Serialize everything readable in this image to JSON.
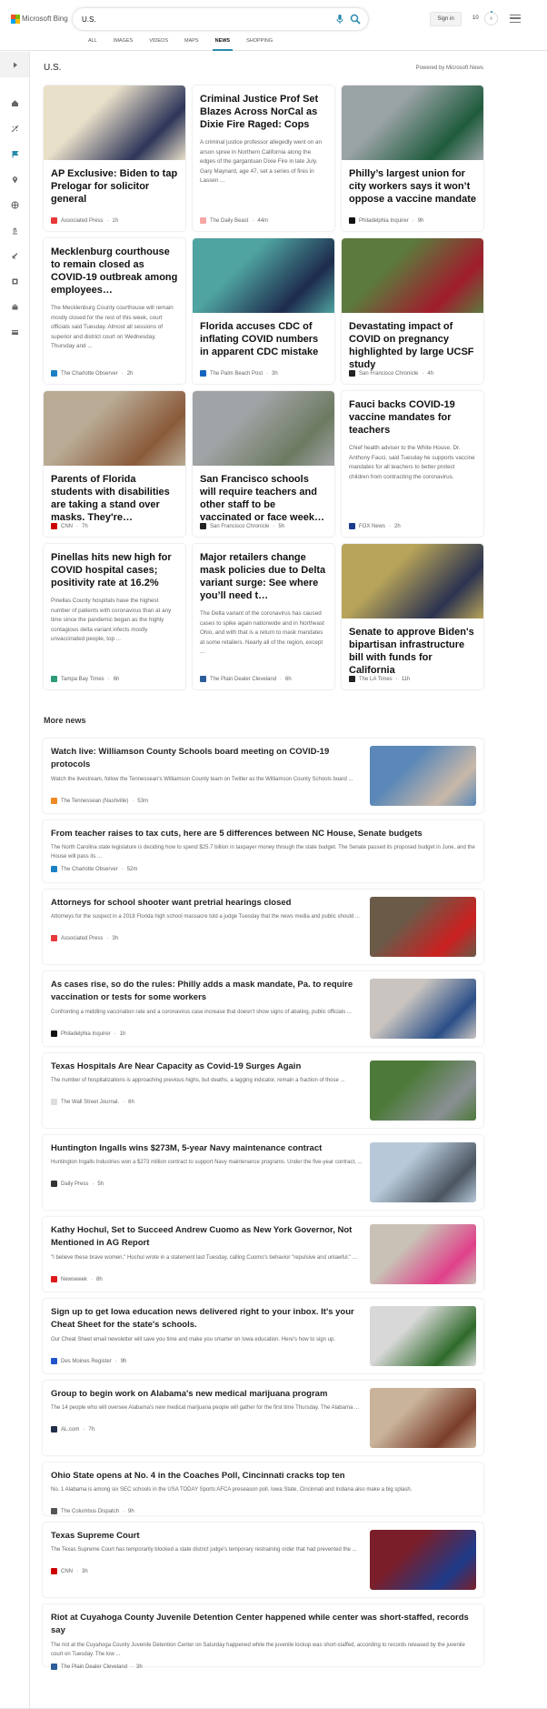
{
  "header": {
    "brand": "Microsoft Bing",
    "logo_colors": [
      "#f25022",
      "#7fba00",
      "#00a4ef",
      "#ffb900"
    ],
    "search_value": "U.S.",
    "tabs": [
      {
        "label": "ALL"
      },
      {
        "label": "IMAGES"
      },
      {
        "label": "VIDEOS"
      },
      {
        "label": "MAPS"
      },
      {
        "label": "NEWS",
        "active": true
      },
      {
        "label": "SHOPPING"
      }
    ],
    "signin": "Sign in",
    "points": "10",
    "accent": "#2a8bad"
  },
  "sidebar": {
    "items": [
      "chevron-right",
      "home",
      "sports",
      "flag",
      "location-pin",
      "globe",
      "microscope",
      "rocket",
      "film",
      "bank",
      "credit-card"
    ]
  },
  "section": {
    "title": "U.S.",
    "powered_by": "Powered by Microsoft News"
  },
  "cards": [
    {
      "title": "AP Exclusive: Biden to tap Prelogar for solicitor general",
      "source": "Associated Press",
      "time": "1h",
      "logo": "#e8383b",
      "img": [
        "#e9e0c9",
        "#2d3558"
      ]
    },
    {
      "title": "Criminal Justice Prof Set Blazes Across NorCal as Dixie Fire Raged: Cops",
      "snippet": "A criminal justice professor allegedly went on an arson spree in Northern California along the edges of the gargantuan Dixie Fire in late July. Gary Maynard, age 47, set a series of fires in Lassen ...",
      "source": "The Daily Beast",
      "time": "44m",
      "logo": "#f7a6a6"
    },
    {
      "title": "Philly’s largest union for city workers says it won’t oppose a vaccine mandate",
      "source": "Philadelphia Inquirer",
      "time": "9h",
      "logo": "#111111",
      "img": [
        "#9aa3a6",
        "#1f5b3d"
      ]
    },
    {
      "title": "Mecklenburg courthouse to remain closed as COVID-19 outbreak among employees…",
      "snippet": "The Mecklenburg County courthouse will remain mostly closed for the rest of this week, court officials said Tuesday. Almost all sessions of superior and district court on Wednesday, Thursday and ...",
      "source": "The Charlotte Observer",
      "time": "2h",
      "logo": "#1d7fc4"
    },
    {
      "title": "Florida accuses CDC of inflating COVID numbers in apparent CDC mistake",
      "source": "The Palm Beach Post",
      "time": "3h",
      "logo": "#1565c0",
      "img": [
        "#4fa3a0",
        "#1d2b4c"
      ]
    },
    {
      "title": "Devastating impact of COVID on pregnancy highlighted by large UCSF study",
      "source": "San Francisco Chronicle",
      "time": "4h",
      "logo": "#222222",
      "img": [
        "#5c7a3d",
        "#a01c2c"
      ]
    },
    {
      "title": "Parents of Florida students with disabilities are taking a stand over masks. They're…",
      "source": "CNN",
      "time": "7h",
      "logo": "#cc0000",
      "img": [
        "#b9ab95",
        "#8a5a3a"
      ]
    },
    {
      "title": "San Francisco schools will require teachers and other staff to be vaccinated or face week…",
      "source": "San Francisco Chronicle",
      "time": "5h",
      "logo": "#222222",
      "img": [
        "#a1a4a6",
        "#6d7a61"
      ]
    },
    {
      "title": "Fauci backs COVID-19 vaccine mandates for teachers",
      "snippet": "Chief health adviser to the White House, Dr. Anthony Fauci, said Tuesday he supports vaccine mandates for all teachers to better protect children from contracting the coronavirus.",
      "source": "FOX News",
      "time": "2h",
      "logo": "#1a3b8c"
    },
    {
      "title": "Pinellas hits new high for COVID hospital cases; positivity rate at 16.2%",
      "snippet": "Pinellas County hospitals have the highest number of patients with coronavirus than at any time since the pandemic began as the highly contagious delta variant infects mostly unvaccinated people, top ...",
      "source": "Tampa Bay Times",
      "time": "6h",
      "logo": "#2e9b7a"
    },
    {
      "title": "Major retailers change mask policies due to Delta variant surge: See where you’ll need t…",
      "snippet": "The Delta variant of the coronavirus has caused cases to spike again nationwide and in Northeast Ohio, and with that is a return to mask mandates at some retailers. Nearly all of the region, except ...",
      "source": "The Plain Dealer Cleveland",
      "time": "6h",
      "logo": "#2b5d9a"
    },
    {
      "title": "Senate to approve Biden's bipartisan infrastructure bill with funds for California",
      "source": "The LA Times",
      "time": "11h",
      "logo": "#222222",
      "img": [
        "#b8a45a",
        "#2b3350"
      ]
    }
  ],
  "more_news": {
    "title": "More news",
    "items": [
      {
        "title": "Watch live: Williamson County Schools board meeting on COVID-19 protocols",
        "snippet": "Watch the livestream, follow the Tennessean's Williamson County team on Twitter as the Williamson County Schools board ...",
        "source": "The Tennessean (Nashville)",
        "time": "53m",
        "logo": "#f08a24",
        "img": [
          "#5b88b8",
          "#c9b8a8"
        ]
      },
      {
        "title": "From teacher raises to tax cuts, here are 5 differences between NC House, Senate budgets",
        "snippet": "The North Carolina state legislature is deciding how to spend $25.7 billion in taxpayer money through the state budget. The Senate passed its proposed budget in June, and the House will pass its ...",
        "source": "The Charlotte Observer",
        "time": "52m",
        "logo": "#1d7fc4"
      },
      {
        "title": "Attorneys for school shooter want pretrial hearings closed",
        "snippet": "Attorneys for the suspect in a 2018 Florida high school massacre told a judge Tuesday that the news media and public should ...",
        "source": "Associated Press",
        "time": "3h",
        "logo": "#e8383b",
        "img": [
          "#6b5a48",
          "#cc2020"
        ]
      },
      {
        "title": "As cases rise, so do the rules: Philly adds a mask mandate, Pa. to require vaccination or tests for some workers",
        "snippet": "Confronting a middling vaccination rate and a coronavirus case increase that doesn't show signs of abating, public officials ...",
        "source": "Philadelphia Inquirer",
        "time": "1h",
        "logo": "#111111",
        "img": [
          "#c9c4bf",
          "#2b4f88"
        ]
      },
      {
        "title": "Texas Hospitals Are Near Capacity as Covid-19 Surges Again",
        "snippet": "The number of hospitalizations is approaching previous highs, but deaths, a lagging indicator, remain a fraction of those ...",
        "source": "The Wall Street Journal.",
        "time": "6h",
        "logo": "#dddddd",
        "img": [
          "#4d7a3a",
          "#8a8f94"
        ]
      },
      {
        "title": "Huntington Ingalls wins $273M, 5-year Navy maintenance contract",
        "snippet": "Huntington Ingalls Industries won a $273 million contract to support Navy maintenance programs. Under the five-year contract, ...",
        "source": "Daily Press",
        "time": "5h",
        "logo": "#333333",
        "img": [
          "#b7c9d9",
          "#4a5560"
        ]
      },
      {
        "title": "Kathy Hochul, Set to Succeed Andrew Cuomo as New York Governor, Not Mentioned in AG Report",
        "snippet": "\"I believe these brave women,\" Hochul wrote in a statement last Tuesday, calling Cuomo's behavior \"repulsive and unlawful.\" ...",
        "source": "Newsweek",
        "time": "8h",
        "logo": "#e01a1a",
        "img": [
          "#c9c1b5",
          "#e0408a"
        ]
      },
      {
        "title": "Sign up to get Iowa education news delivered right to your inbox. It's your Cheat Sheet for the state's schools.",
        "snippet": "Our Cheat Sheet email newsletter will save you time and make you smarter on Iowa education. Here's how to sign up.",
        "source": "Des Moines Register",
        "time": "9h",
        "logo": "#2255cc",
        "img": [
          "#d8d8d8",
          "#2f6a2a"
        ]
      },
      {
        "title": "Group to begin work on Alabama's new medical marijuana program",
        "snippet": "The 14 people who will oversee Alabama's new medical marijuana people will gather for the first time Thursday. The Alabama ...",
        "source": "AL.com",
        "time": "7h",
        "logo": "#223049",
        "img": [
          "#c9b39a",
          "#7a3d2a"
        ]
      },
      {
        "title": "Ohio State opens at No. 4 in the Coaches Poll, Cincinnati cracks top ten",
        "snippet": "No. 1 Alabama is among six SEC schools in the USA TODAY Sports AFCA preseason poll. Iowa State, Cincinnati and Indiana also make a big splash.",
        "source": "The Columbus Dispatch",
        "time": "9h",
        "logo": "#555555"
      },
      {
        "title": "Texas Supreme Court",
        "snippet": "The Texas Supreme Court has temporarily blocked a state district judge's temporary restraining order that had prevented the ...",
        "source": "CNN",
        "time": "3h",
        "logo": "#cc0000",
        "img": [
          "#7a1f2a",
          "#1f3b8a"
        ]
      },
      {
        "title": "Riot at Cuyahoga County Juvenile Detention Center happened while center was short-staffed, records say",
        "snippet": "The riot at the Cuyahoga County Juvenile Detention Center on Saturday happened while the juvenile lockup was short-staffed, according to records released by the juvenile court on Tuesday. The low ...",
        "source": "The Plain Dealer Cleveland",
        "time": "3h",
        "logo": "#2b5d9a"
      }
    ]
  }
}
